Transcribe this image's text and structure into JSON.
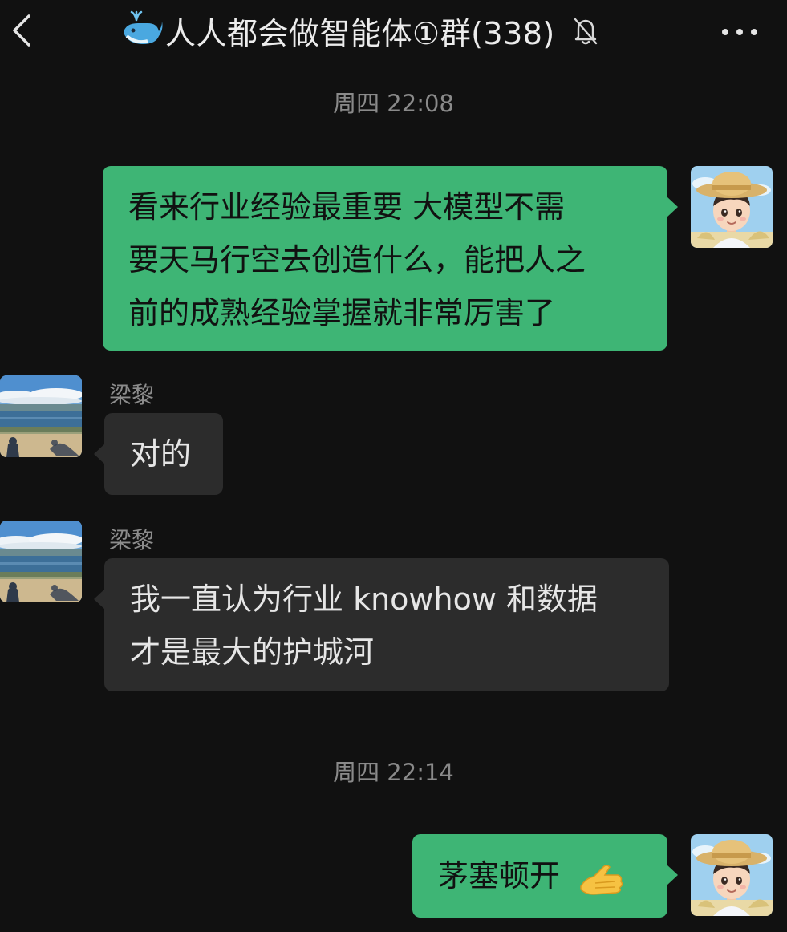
{
  "header": {
    "back_icon": "chevron-left-icon",
    "group_icon": "whale-emoji",
    "title": "人人都会做智能体①群(338)",
    "mute_icon": "bell-slash-icon",
    "more_icon": "ellipsis-icon"
  },
  "messages": [
    {
      "type": "timestamp",
      "text": "周四 22:08"
    },
    {
      "type": "message",
      "sender": "self",
      "lines": [
        "看来行业经验最重要  大模型不需",
        "要天马行空去创造什么，能把人之",
        "前的成熟经验掌握就非常厉害了"
      ]
    },
    {
      "type": "message",
      "sender": "other",
      "name": "梁黎",
      "lines": [
        "对的"
      ]
    },
    {
      "type": "message",
      "sender": "other",
      "name": "梁黎",
      "lines": [
        "我一直认为行业 knowhow 和数据",
        "才是最大的护城河"
      ]
    },
    {
      "type": "timestamp",
      "text": "周四 22:14"
    },
    {
      "type": "message",
      "sender": "self",
      "lines": [
        "茅塞顿开"
      ],
      "emoji": "folded-hands-emoji"
    }
  ],
  "colors": {
    "background": "#111111",
    "self_bubble": "#3eb575",
    "other_bubble": "#2c2c2c",
    "timestamp": "#8a8a8a"
  }
}
